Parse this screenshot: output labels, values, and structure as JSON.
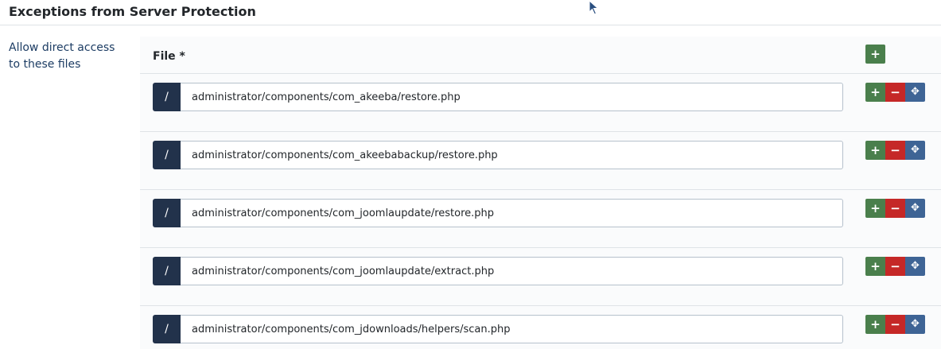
{
  "section": {
    "title": "Exceptions from Server Protection"
  },
  "field": {
    "label": "Allow direct access to these files"
  },
  "subform": {
    "column_header": "File *",
    "add_glyph": "+",
    "remove_glyph": "−",
    "move_glyph": "✥",
    "prefix": "/",
    "rows": [
      {
        "value": "administrator/components/com_akeeba/restore.php"
      },
      {
        "value": "administrator/components/com_akeebabackup/restore.php"
      },
      {
        "value": "administrator/components/com_joomlaupdate/restore.php"
      },
      {
        "value": "administrator/components/com_joomlaupdate/extract.php"
      },
      {
        "value": "administrator/components/com_jdownloads/helpers/scan.php"
      }
    ]
  },
  "colors": {
    "add": "#4a7f4c",
    "remove": "#c52827",
    "move": "#3e6495",
    "prefix": "#22324b",
    "label": "#1d3d64"
  },
  "icons": {
    "cursor": "mouse-pointer-icon",
    "move": "move-arrows-icon"
  }
}
